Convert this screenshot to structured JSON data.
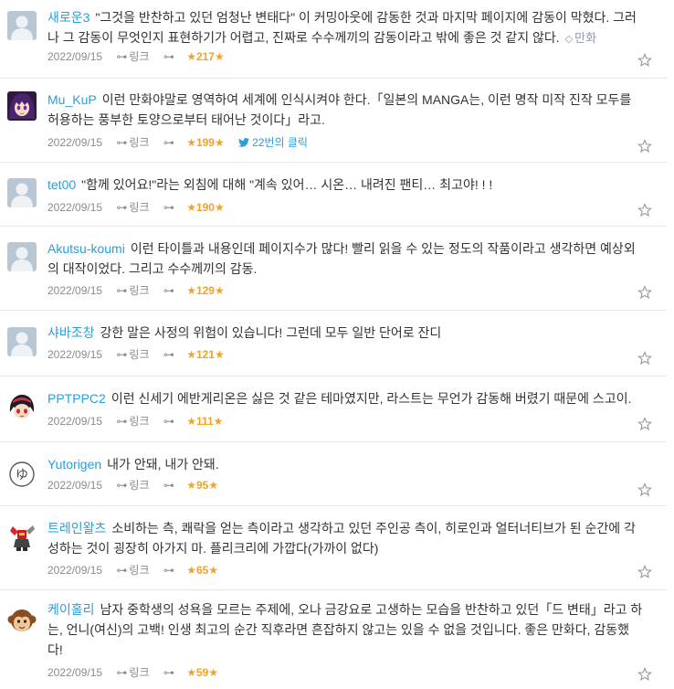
{
  "ui": {
    "link_label": "링크",
    "link_icon": "link-icon",
    "favorite_icon": "star-outline-icon",
    "accent": "#2a9fd6",
    "star_color": "#f0a32a"
  },
  "comments": [
    {
      "user": "새로운3",
      "text": "\"그것을 반찬하고 있던 엄청난 변태다\" 이 커밍아웃에 감동한 것과 마지막 페이지에 감동이 막혔다. 그러나 그 감동이 무엇인지 표현하기가 어렵고, 진짜로 수수께끼의 감동이라고 밖에 좋은 것 같지 않다.",
      "tag": "만화",
      "date": "2022/09/15",
      "stars": "★217★",
      "avatar": "default-avatar"
    },
    {
      "user": "Mu_KuP",
      "text": "이런 만화야말로 영역하여 세계에 인식시켜야 한다.「일본의 MANGA는, 이런 명작 미작 진작 모두를 허용하는 풍부한 토양으로부터 태어난 것이다」라고.",
      "date": "2022/09/15",
      "stars": "★199★",
      "tweet": "22번의 클릭",
      "avatar": "anime-avatar-purple"
    },
    {
      "user": "tet00",
      "text": "\"함께 있어요!\"라는 외침에 대해 \"계속 있어… 시온… 내려진 팬티… 최고야! ! !",
      "date": "2022/09/15",
      "stars": "★190★",
      "avatar": "default-avatar"
    },
    {
      "user": "Akutsu-koumi",
      "text": "이런 타이틀과 내용인데 페이지수가 많다! 빨리 읽을 수 있는 정도의 작품이라고 생각하면 예상외의 대작이었다. 그리고 수수께끼의 감동.",
      "date": "2022/09/15",
      "stars": "★129★",
      "avatar": "default-avatar"
    },
    {
      "user": "샤바조창",
      "text": "강한 말은 사정의 위험이 있습니다! 그런데 모두 일반 단어로 잔디",
      "date": "2022/09/15",
      "stars": "★121★",
      "avatar": "default-avatar"
    },
    {
      "user": "PPTPPC2",
      "text": "이런 신세기 에반게리온은 싫은 것 같은 테마였지만, 라스트는 무언가 감동해 버렸기 때문에 스고이.",
      "date": "2022/09/15",
      "stars": "★111★",
      "avatar": "anime-avatar-red"
    },
    {
      "user": "Yutorigen",
      "text": "내가 안돼, 내가 안돼.",
      "date": "2022/09/15",
      "stars": "★95★",
      "avatar": "hiragana-yu-avatar",
      "avatar_glyph": "ゆ"
    },
    {
      "user": "트레인왈츠",
      "text": "소비하는 측, 쾌락을 얻는 측이라고 생각하고 있던 주인공 측이, 히로인과 얼터너티브가 된 순간에 각성하는 것이 굉장히 아가지 마. 플리크리에 가깝다(가까이 없다)",
      "date": "2022/09/15",
      "stars": "★65★",
      "avatar": "robot-avatar"
    },
    {
      "user": "케이홀리",
      "text": "남자 중학생의 성욕을 모르는 주제에, 오나 금강요로 고생하는 모습을 반찬하고 있던「드 변태」라고 하는, 언니(여신)의 고백! 인생 최고의 순간 직후라면 흔잡하지 않고는 있을 수 없을 것입니다. 좋은 만화다, 감동했다!",
      "date": "2022/09/15",
      "stars": "★59★",
      "avatar": "monkey-avatar"
    }
  ]
}
